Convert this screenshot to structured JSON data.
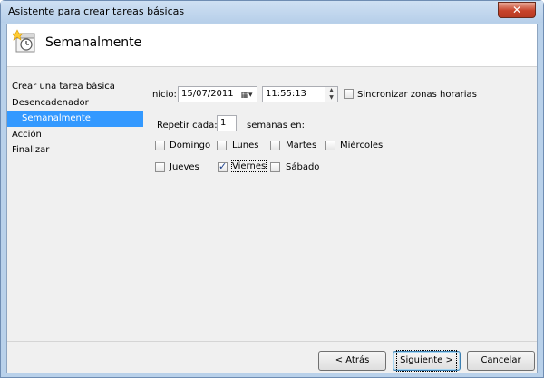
{
  "window": {
    "title": "Asistente para crear tareas básicas",
    "close_glyph": "✕"
  },
  "header": {
    "title": "Semanalmente",
    "icon": "calendar-clock-icon"
  },
  "nav": {
    "items": [
      {
        "label": "Crear una tarea básica"
      },
      {
        "label": "Desencadenador"
      },
      {
        "label": "Semanalmente"
      },
      {
        "label": "Acción"
      },
      {
        "label": "Finalizar"
      }
    ]
  },
  "form": {
    "start_label": "Inicio:",
    "start_date": "15/07/2011",
    "start_time": "11:55:13",
    "sync_label": "Sincronizar zonas horarias",
    "repeat_label": "Repetir cada:",
    "repeat_value": "1",
    "repeat_suffix": "semanas en:",
    "days": [
      {
        "label": "Domingo",
        "checked": false
      },
      {
        "label": "Lunes",
        "checked": false
      },
      {
        "label": "Martes",
        "checked": false
      },
      {
        "label": "Miércoles",
        "checked": false
      },
      {
        "label": "Jueves",
        "checked": false
      },
      {
        "label": "Viernes",
        "checked": true
      },
      {
        "label": "Sábado",
        "checked": false
      }
    ]
  },
  "buttons": {
    "back": "< Atrás",
    "next": "Siguiente >",
    "cancel": "Cancelar"
  }
}
